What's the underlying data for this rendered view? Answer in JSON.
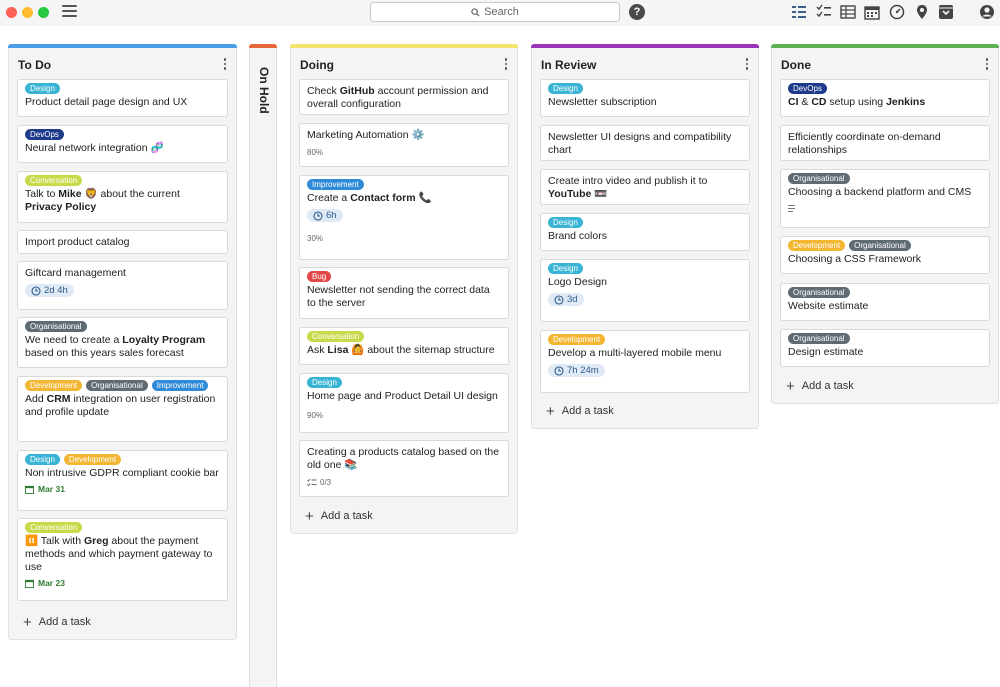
{
  "toolbar": {
    "search_placeholder": "Search",
    "help_label": "?",
    "view_icons": [
      "board-view-icon",
      "checklist-view-icon",
      "table-view-icon",
      "calendar-view-icon",
      "dashboard-view-icon",
      "map-view-icon",
      "archive-icon",
      "account-icon"
    ]
  },
  "columns": [
    {
      "title": "To Do",
      "color": "#4a9ee8",
      "cards": [
        {
          "tags": [
            {
              "label": "Design",
              "type": "design"
            }
          ],
          "title": "Product detail page design and UX"
        },
        {
          "tags": [
            {
              "label": "DevOps",
              "type": "devops"
            }
          ],
          "title": "Neural network integration 🧬"
        },
        {
          "tags": [
            {
              "label": "Conversation",
              "type": "conversation"
            }
          ],
          "title_html": "Talk to <b>Mike</b> 🦁 about the current <b>Privacy Policy</b>"
        },
        {
          "tags": [],
          "title": "Import product catalog"
        },
        {
          "tags": [],
          "title": "Giftcard management",
          "time": "2d 4h"
        },
        {
          "tags": [
            {
              "label": "Organisational",
              "type": "organisational"
            }
          ],
          "title_html": "We need to create a <b>Loyalty Program</b> based on this years sales forecast"
        },
        {
          "tags": [
            {
              "label": "Development",
              "type": "development"
            },
            {
              "label": "Organisational",
              "type": "organisational"
            },
            {
              "label": "Improvement",
              "type": "improvement"
            }
          ],
          "title_html": "Add <b>CRM</b> integration on user registration and profile update"
        },
        {
          "tags": [
            {
              "label": "Design",
              "type": "design"
            },
            {
              "label": "Development",
              "type": "development"
            }
          ],
          "title": "Non intrusive GDPR compliant cookie bar",
          "date": "Mar 31"
        },
        {
          "tags": [
            {
              "label": "Conversation",
              "type": "conversation"
            }
          ],
          "title_html": "⏸️ Talk with <b>Greg</b> about the payment methods and which payment gateway to use",
          "date": "Mar 23"
        }
      ],
      "add_label": "Add a task"
    },
    {
      "title": "On Hold",
      "color": "#e8663c",
      "cards": []
    },
    {
      "title": "Doing",
      "color": "#f3e36a",
      "cards": [
        {
          "tags": [],
          "title_html": "Check <b>GitHub</b> account permission and overall configuration"
        },
        {
          "tags": [],
          "title": "Marketing Automation ⚙️",
          "progress": "80%"
        },
        {
          "tags": [
            {
              "label": "Improvement",
              "type": "improvement"
            }
          ],
          "title_html": "Create a <b>Contact form</b> 📞",
          "time": "6h",
          "progress": "30%"
        },
        {
          "tags": [
            {
              "label": "Bug",
              "type": "bug"
            }
          ],
          "title": "Newsletter not sending the correct data to the server"
        },
        {
          "tags": [
            {
              "label": "Conversation",
              "type": "conversation"
            }
          ],
          "title_html": "Ask <b>Lisa</b> 🙆 about the sitemap structure"
        },
        {
          "tags": [
            {
              "label": "Design",
              "type": "design"
            }
          ],
          "title": "Home page and Product Detail UI design",
          "progress": "90%"
        },
        {
          "tags": [],
          "title": "Creating a products catalog based on the old one 📚",
          "checklist": "0/3"
        }
      ],
      "add_label": "Add a task"
    },
    {
      "title": "In Review",
      "color": "#9b34b8",
      "cards": [
        {
          "tags": [
            {
              "label": "Design",
              "type": "design"
            }
          ],
          "title": "Newsletter subscription"
        },
        {
          "tags": [],
          "title": "Newsletter UI designs and compatibility chart"
        },
        {
          "tags": [],
          "title_html": "Create intro video and publish it to <b>YouTube</b> 📼"
        },
        {
          "tags": [
            {
              "label": "Design",
              "type": "design"
            }
          ],
          "title": "Brand colors"
        },
        {
          "tags": [
            {
              "label": "Design",
              "type": "design"
            }
          ],
          "title": "Logo Design",
          "time": "3d"
        },
        {
          "tags": [
            {
              "label": "Development",
              "type": "development"
            }
          ],
          "title": "Develop a multi-layered mobile menu",
          "time": "7h 24m"
        }
      ],
      "add_label": "Add a task"
    },
    {
      "title": "Done",
      "color": "#5fb158",
      "cards": [
        {
          "tags": [
            {
              "label": "DevOps",
              "type": "devops"
            }
          ],
          "title_html": "<b>CI</b> &amp; <b>CD</b> setup using <b>Jenkins</b>"
        },
        {
          "tags": [],
          "title": "Efficiently coordinate on-demand relationships"
        },
        {
          "tags": [
            {
              "label": "Organisational",
              "type": "organisational"
            }
          ],
          "title": "Choosing a backend platform and CMS",
          "has_description": true
        },
        {
          "tags": [
            {
              "label": "Development",
              "type": "development"
            },
            {
              "label": "Organisational",
              "type": "organisational"
            }
          ],
          "title": "Choosing a CSS Framework"
        },
        {
          "tags": [
            {
              "label": "Organisational",
              "type": "organisational"
            }
          ],
          "title": "Website estimate"
        },
        {
          "tags": [
            {
              "label": "Organisational",
              "type": "organisational"
            }
          ],
          "title": "Design estimate"
        }
      ],
      "add_label": "Add a task"
    }
  ]
}
